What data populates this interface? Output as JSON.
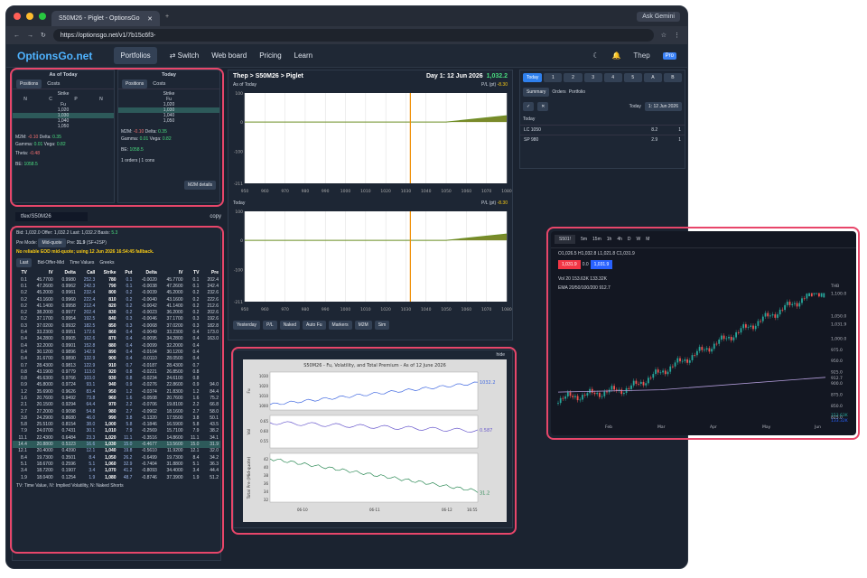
{
  "browser": {
    "tab_title": "S50M26 - Piglet - OptionsGo",
    "url": "https://optionsgo.net/v1/7b15c6f3-",
    "ask": "Ask Gemini"
  },
  "nav": {
    "logo": "OptionsGo.net",
    "items": [
      "Portfolios",
      "Switch",
      "Web board",
      "Pricing",
      "Learn"
    ],
    "user": "Thep",
    "pro": "Pro"
  },
  "left": {
    "p1": "As of Today",
    "p2": "Today",
    "tabs": [
      "Positions",
      "Costs"
    ],
    "strikes": [
      "Fu",
      "1,020",
      "1,030",
      "1,040",
      "1,050"
    ],
    "m2m": "-0.10",
    "delta": "0.35",
    "gamma": "0.01",
    "vega": "0.82",
    "theta": "-0.48",
    "be": "1058.5",
    "orders": "1 orders | 1 cons",
    "m2mdetails": "M2M details"
  },
  "symbol": "tfex/S50M26",
  "copy": "copy",
  "quote": {
    "bid": "1,032.0",
    "offer": "1,032.2",
    "last": "1,032.2",
    "basis": "5.3",
    "premode": "Mid-quote",
    "pre": "31.9",
    "pre_note": "(SF+2SP)",
    "warn": "No reliable EOD mid-quote; using 12 Jun 2026 16:54:45 fallback."
  },
  "chain_tabs": [
    "Last",
    "Bid-Offer-Mid",
    "Time Values",
    "Greeks"
  ],
  "chain_cols": [
    "TV",
    "IV",
    "Delta",
    "Call",
    "Strike",
    "Put",
    "Delta",
    "IV",
    "TV",
    "Pre"
  ],
  "chain": [
    [
      "0.1",
      "45.7700",
      "0.9980",
      "252.3",
      "780",
      "0.1",
      "-0.0020",
      "45.7700",
      "0.1",
      "202.4"
    ],
    [
      "0.1",
      "47.2600",
      "0.9962",
      "242.3",
      "790",
      "0.1",
      "-0.0038",
      "47.2600",
      "0.1",
      "242.4"
    ],
    [
      "0.2",
      "45.2000",
      "0.9961",
      "232.4",
      "800",
      "0.2",
      "-0.0039",
      "45.2000",
      "0.2",
      "232.6"
    ],
    [
      "0.2",
      "43.1600",
      "0.9960",
      "222.4",
      "810",
      "0.2",
      "-0.0040",
      "43.1600",
      "0.2",
      "222.6"
    ],
    [
      "0.2",
      "41.1400",
      "0.9958",
      "212.4",
      "820",
      "0.2",
      "-0.0042",
      "41.1400",
      "0.2",
      "212.6"
    ],
    [
      "0.2",
      "38.2000",
      "0.9977",
      "202.4",
      "830",
      "0.2",
      "-0.0023",
      "36.2000",
      "0.2",
      "202.6"
    ],
    [
      "0.2",
      "37.1700",
      "0.9954",
      "192.5",
      "840",
      "0.3",
      "-0.0046",
      "37.1700",
      "0.3",
      "192.6"
    ],
    [
      "0.3",
      "37.0200",
      "0.9932",
      "182.5",
      "850",
      "0.3",
      "-0.0068",
      "37.0200",
      "0.3",
      "182.8"
    ],
    [
      "0.4",
      "33.2300",
      "0.9951",
      "172.6",
      "860",
      "0.4",
      "-0.0049",
      "33.2300",
      "0.4",
      "173.0"
    ],
    [
      "0.4",
      "34.2800",
      "0.9905",
      "162.6",
      "870",
      "0.4",
      "-0.0095",
      "34.2800",
      "0.4",
      "163.0"
    ],
    [
      "0.4",
      "32.2000",
      "0.9901",
      "152.8",
      "880",
      "0.4",
      "-0.0099",
      "32.2000",
      "0.4",
      ""
    ],
    [
      "0.4",
      "30.1200",
      "0.9896",
      "142.9",
      "890",
      "0.4",
      "-0.0104",
      "30.1200",
      "0.4",
      ""
    ],
    [
      "0.4",
      "31.6700",
      "0.9890",
      "132.9",
      "900",
      "0.4",
      "-0.0110",
      "28.0500",
      "0.4",
      ""
    ],
    [
      "0.7",
      "28.4300",
      "0.9813",
      "122.9",
      "910",
      "0.7",
      "-0.0187",
      "28.4300",
      "0.7",
      ""
    ],
    [
      "0.8",
      "43.1900",
      "0.9779",
      "113.0",
      "920",
      "0.8",
      "-0.0221",
      "26.8500",
      "0.8",
      ""
    ],
    [
      "0.8",
      "45.6300",
      "0.9766",
      "103.0",
      "930",
      "0.8",
      "-0.0234",
      "24.6100",
      "0.8",
      ""
    ],
    [
      "0.9",
      "45.8000",
      "0.9724",
      "93.1",
      "940",
      "0.9",
      "-0.0276",
      "22.8600",
      "0.9",
      "94.0"
    ],
    [
      "1.2",
      "35.6900",
      "0.9626",
      "83.4",
      "950",
      "1.2",
      "-0.0374",
      "21.8300",
      "1.2",
      "84.4"
    ],
    [
      "1.6",
      "20.7600",
      "0.9492",
      "73.8",
      "960",
      "1.6",
      "-0.0508",
      "20.7600",
      "1.6",
      "75.2"
    ],
    [
      "2.1",
      "20.1500",
      "0.9294",
      "64.4",
      "970",
      "2.2",
      "-0.0706",
      "19.8100",
      "2.2",
      "66.8"
    ],
    [
      "2.7",
      "27.2000",
      "0.9098",
      "54.8",
      "980",
      "2.7",
      "-0.0902",
      "18.1600",
      "2.7",
      "58.0"
    ],
    [
      "3.8",
      "24.2900",
      "0.8680",
      "46.0",
      "990",
      "3.8",
      "-0.1320",
      "17.5500",
      "3.8",
      "50.1"
    ],
    [
      "5.8",
      "25.5100",
      "0.8154",
      "38.0",
      "1,000",
      "5.8",
      "-0.1846",
      "16.5900",
      "5.8",
      "43.5"
    ],
    [
      "7.9",
      "24.0700",
      "0.7431",
      "30.1",
      "1,010",
      "7.9",
      "-0.2569",
      "15.7100",
      "7.9",
      "38.2"
    ],
    [
      "11.1",
      "22.4300",
      "0.6484",
      "23.3",
      "1,020",
      "11.1",
      "-0.3516",
      "14.8600",
      "11.1",
      "34.1"
    ],
    [
      "14.4",
      "20.8800",
      "0.5323",
      "16.6",
      "1,030",
      "15.0",
      "-0.4677",
      "13.5600",
      "15.0",
      "31.9"
    ],
    [
      "12.1",
      "20.4000",
      "0.4390",
      "12.1",
      "1,040",
      "19.8",
      "-0.5610",
      "11.9200",
      "12.1",
      "32.0"
    ],
    [
      "8.4",
      "19.7300",
      "0.3501",
      "8.4",
      "1,050",
      "26.2",
      "-0.6499",
      "19.7300",
      "8.4",
      "34.2"
    ],
    [
      "5.1",
      "18.6700",
      "0.2596",
      "5.1",
      "1,060",
      "32.9",
      "-0.7404",
      "31.8800",
      "5.1",
      "36.3"
    ],
    [
      "3.4",
      "18.7200",
      "0.1907",
      "3.4",
      "1,070",
      "41.2",
      "-0.8093",
      "34.4000",
      "3.4",
      "44.4"
    ],
    [
      "1.9",
      "18.0400",
      "0.1254",
      "1.9",
      "1,080",
      "48.7",
      "-0.8746",
      "37.3900",
      "1.9",
      "51.2"
    ]
  ],
  "chain_footer": "TV: Time Value, IV: Implied Volatility, N: Naked Shorts",
  "payoff": {
    "title": "Thep > S50M26 > Piglet",
    "day": "Day 1: 12 Jun 2026",
    "price": "1,032.2",
    "pnl": "-8.30",
    "asof": "As of Today",
    "today": "Today",
    "watermark": "OptionsGo.net",
    "x_ticks": [
      "950",
      "960",
      "970",
      "980",
      "990",
      "1000",
      "1010",
      "1020",
      "1030",
      "1040",
      "1050",
      "1060",
      "1070",
      "1080"
    ],
    "y_ticks": [
      "100",
      "0",
      "-100",
      "-211"
    ],
    "buttons": [
      "Yesterday",
      "P/L",
      "Naked",
      "Auto Fu",
      "Markers",
      "M2M",
      "Sim"
    ]
  },
  "fvchart": {
    "title": "S50M26 - Fu, Volatility, and Total Premium - As of 12 June 2026",
    "hide": "hide",
    "fu": "1032.2",
    "vol": "0.587",
    "pre": "31.2",
    "y1": [
      "1030",
      "1020",
      "1010",
      "1000"
    ],
    "y2": [
      "0.65",
      "0.60",
      "0.55"
    ],
    "y3": [
      "42",
      "40",
      "38",
      "36",
      "34",
      "32"
    ],
    "xticks": [
      "06-10",
      "06-11",
      "06-12"
    ],
    "ylabels": [
      "Fu",
      "Vol",
      "Total Pre (Mid-quote)"
    ],
    "end": "16:55"
  },
  "right": {
    "tabs": [
      "Today",
      "1",
      "2",
      "3",
      "4",
      "5",
      "A",
      "B"
    ],
    "subtabs": [
      "Summary",
      "Orders",
      "Portfolio"
    ],
    "date_label": "Today",
    "date": "1: 12 Jun 2026",
    "list_head": "Today",
    "rows": [
      {
        "name": "LC 1050",
        "price": "8.2",
        "qty": "1"
      },
      {
        "name": "SP 980",
        "price": "2.9",
        "qty": "1"
      }
    ]
  },
  "tv": {
    "symbol": "S501!",
    "intervals": [
      "5m",
      "15m",
      "1h",
      "4h",
      "D",
      "W",
      "M"
    ],
    "ohlc": "O1,026.5 H1,032.8 L1,021.8 C1,031.9",
    "sell": "1,031.9",
    "buy": "1,031.9",
    "spread": "0.0",
    "vol": "Vol 20  153.63K  133.32K",
    "ema": "EMA 20/50/100/200  912.7",
    "prices": [
      "1,100.0",
      "1,050.0",
      "1,031.9",
      "1,000.0",
      "975.0",
      "950.0",
      "925.0",
      "912.7",
      "900.0",
      "875.0",
      "850.0",
      "825.0"
    ],
    "months": [
      "Feb",
      "Mar",
      "Apr",
      "May",
      "Jun"
    ],
    "cur": "THB",
    "vol1": "153.63K",
    "vol2": "133.32K"
  }
}
